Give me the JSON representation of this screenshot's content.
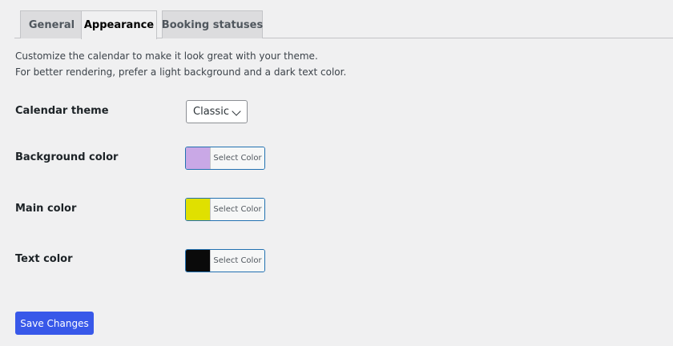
{
  "tabs": [
    {
      "label": "General",
      "active": false
    },
    {
      "label": "Appearance",
      "active": true
    },
    {
      "label": "Booking statuses",
      "active": false
    }
  ],
  "description": {
    "line1": "Customize the calendar to make it look great with your theme.",
    "line2": "For better rendering, prefer a light background and a dark text color."
  },
  "settings": {
    "calendar_theme": {
      "label": "Calendar theme",
      "value": "Classic"
    },
    "background_color": {
      "label": "Background color",
      "button_label": "Select Color",
      "color": "#c9a8e6"
    },
    "main_color": {
      "label": "Main color",
      "button_label": "Select Color",
      "color": "#e0e000"
    },
    "text_color": {
      "label": "Text color",
      "button_label": "Select Color",
      "color": "#0a0a0a"
    }
  },
  "save_button": {
    "label": "Save Changes"
  }
}
